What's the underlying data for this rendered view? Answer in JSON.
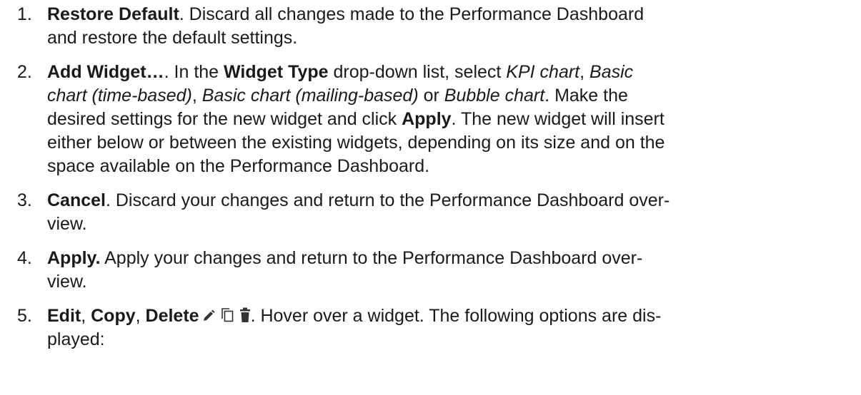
{
  "items": [
    {
      "number": "1.",
      "lines": [
        [
          {
            "t": "Restore Default",
            "s": "b"
          },
          {
            "t": ". Discard all changes made to the Performance Dashboard"
          }
        ],
        [
          {
            "t": "and restore the default settings."
          }
        ]
      ]
    },
    {
      "number": "2.",
      "lines": [
        [
          {
            "t": "Add Widget…",
            "s": "b"
          },
          {
            "t": ". In the "
          },
          {
            "t": "Widget Type",
            "s": "b"
          },
          {
            "t": " drop-down list, select "
          },
          {
            "t": "KPI chart",
            "s": "i"
          },
          {
            "t": ", "
          },
          {
            "t": "Basic",
            "s": "i"
          }
        ],
        [
          {
            "t": "chart (time-based)",
            "s": "i"
          },
          {
            "t": ", "
          },
          {
            "t": "Basic chart (mailing-based)",
            "s": "i"
          },
          {
            "t": " or "
          },
          {
            "t": "Bubble chart",
            "s": "i"
          },
          {
            "t": ". Make the"
          }
        ],
        [
          {
            "t": "desired settings for the new widget and click "
          },
          {
            "t": "Apply",
            "s": "b"
          },
          {
            "t": ". The new widget will insert"
          }
        ],
        [
          {
            "t": "either below or between the existing widgets, depending on its size and on the"
          }
        ],
        [
          {
            "t": "space available on the Performance Dashboard."
          }
        ]
      ]
    },
    {
      "number": "3.",
      "lines": [
        [
          {
            "t": "Cancel",
            "s": "b"
          },
          {
            "t": ". Discard your changes and return to the Performance Dashboard over-"
          }
        ],
        [
          {
            "t": "view."
          }
        ]
      ]
    },
    {
      "number": "4.",
      "lines": [
        [
          {
            "t": "Apply.",
            "s": "b"
          },
          {
            "t": " Apply your changes and return to the Performance Dashboard over-"
          }
        ],
        [
          {
            "t": "view."
          }
        ]
      ]
    },
    {
      "number": "5.",
      "lines": [
        [
          {
            "t": "Edit",
            "s": "b"
          },
          {
            "t": ", "
          },
          {
            "t": "Copy",
            "s": "b"
          },
          {
            "t": ", "
          },
          {
            "t": "Delete",
            "s": "b"
          },
          {
            "icons": [
              "pencil-icon",
              "copy-icon",
              "trash-icon"
            ]
          },
          {
            "t": ". Hover over a widget. The following options are dis-"
          }
        ],
        [
          {
            "t": "played:"
          }
        ]
      ]
    }
  ],
  "colors": {
    "text": "#1a1a1a",
    "icon": "#333333"
  }
}
